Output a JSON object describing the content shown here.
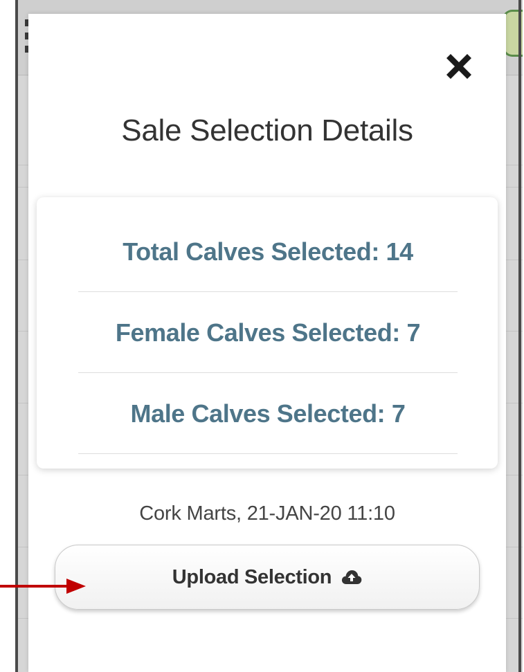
{
  "modal": {
    "title": "Sale Selection Details",
    "close_icon": "close-icon",
    "stats": [
      {
        "label": "Total Calves Selected: 14"
      },
      {
        "label": "Female Calves Selected: 7"
      },
      {
        "label": "Male Calves Selected: 7"
      }
    ],
    "sale_info": "Cork Marts, 21-JAN-20 11:10",
    "upload_button": {
      "label": "Upload Selection",
      "icon": "cloud-upload-icon"
    }
  },
  "colors": {
    "stat_text": "#4e7589",
    "title_text": "#333333",
    "annotation_arrow": "#c00000"
  }
}
